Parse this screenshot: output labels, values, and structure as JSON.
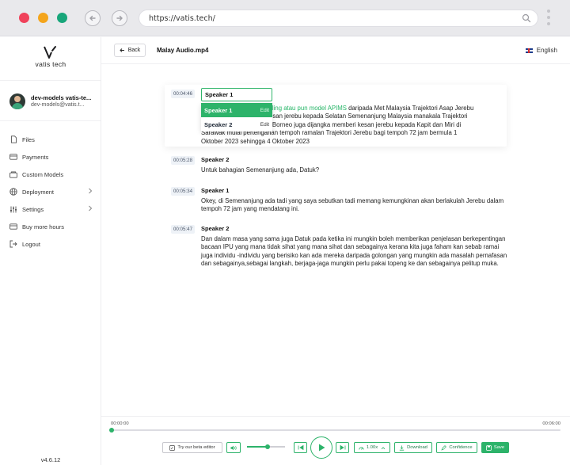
{
  "browser": {
    "url": "https://vatis.tech/"
  },
  "app": {
    "logo_text": "vatis tech",
    "version": "v4.6.12"
  },
  "user": {
    "name": "dev-models vatis-te...",
    "email": "dev-models@vatis.t..."
  },
  "sidebar": {
    "items": [
      {
        "label": "Files",
        "icon": "file-icon",
        "has_chevron": false
      },
      {
        "label": "Payments",
        "icon": "card-icon",
        "has_chevron": false
      },
      {
        "label": "Custom Models",
        "icon": "box-icon",
        "has_chevron": false
      },
      {
        "label": "Deployment",
        "icon": "globe-icon",
        "has_chevron": true
      },
      {
        "label": "Settings",
        "icon": "sliders-icon",
        "has_chevron": true
      },
      {
        "label": "Buy more hours",
        "icon": "card-icon",
        "has_chevron": false
      },
      {
        "label": "Logout",
        "icon": "logout-icon",
        "has_chevron": false
      }
    ]
  },
  "header": {
    "back_label": "Back",
    "file_title": "Malay Audio.mp4",
    "language": "English"
  },
  "speaker_dropdown": {
    "value": "Speaker 1",
    "options": [
      {
        "label": "Speaker 1",
        "action": "Edit",
        "selected": true
      },
      {
        "label": "Speaker 2",
        "action": "Edit",
        "selected": false
      }
    ]
  },
  "segments": [
    {
      "time": "00:04:46",
      "speaker": "Speaker 1",
      "text_highlight": "sling atau pun model APIMS",
      "text_lines": [
        " daripada Met Malaysia Trajektori  Asap Jerebu",
        "esan jerebu kepada Selatan Semenanjung Malaysia manakala Trajektori",
        "i Borneo juga dijangka memberi kesan jerebu kepada Kapit dan Miri di",
        "Sarawak mulai pertengahan tempoh ramalan Trajektori Jerebu bagi tempoh 72 jam bermula 1",
        "Oktober 2023 sehingga 4 Oktober 2023"
      ]
    },
    {
      "time": "00:05:28",
      "speaker": "Speaker 2",
      "text": "Untuk bahagian Semenanjung ada, Datuk?"
    },
    {
      "time": "00:05:34",
      "speaker": "Speaker 1",
      "text": "Okey, di Semenanjung ada tadi yang saya sebutkan tadi memang kemungkinan akan berlakulah Jerebu dalam tempoh 72 jam yang mendatang ini."
    },
    {
      "time": "00:05:47",
      "speaker": "Speaker 2",
      "text": " Dan dalam masa yang sama juga Datuk pada ketika ini mungkin boleh memberikan penjelasan berkepentingan bacaan IPU yang mana tidak sihat yang mana sihat dan sebagainya kerana kita juga faham kan sebab ramai juga individu -individu yang berisiko kan ada mereka daripada golongan yang mungkin ada masalah pernafasan dan sebagainya,sebagai  langkah, berjaga-jaga mungkin perlu pakai topeng ke dan sebagainya pelitup muka."
    }
  ],
  "player": {
    "current_time": "00:00:00",
    "total_time": "00:06:00",
    "progress": 0,
    "volume": 0.55,
    "beta_label": "Try our beta editor",
    "speed": "1.00x",
    "download_label": "Download",
    "confidence_label": "Confidence",
    "save_label": "Save"
  },
  "colors": {
    "accent": "#2db36a",
    "highlight_text": "#26b567"
  }
}
